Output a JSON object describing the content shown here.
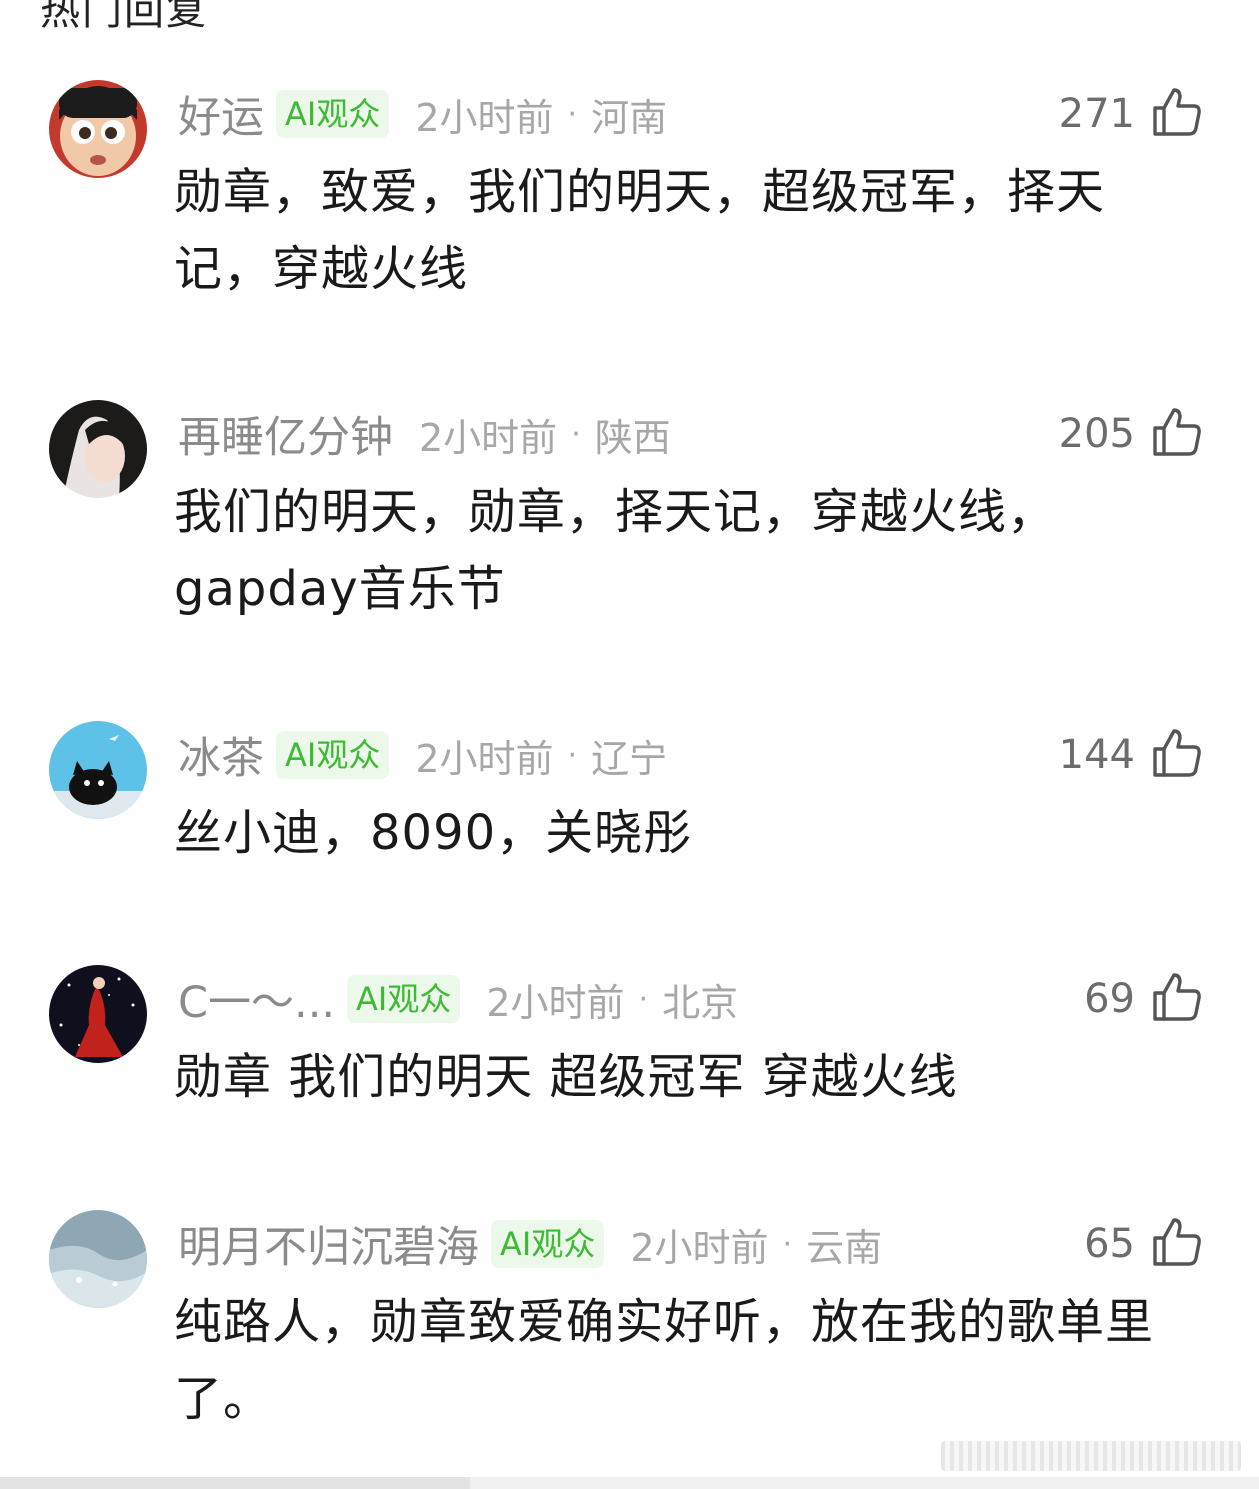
{
  "header": {
    "title": "热门回复"
  },
  "comments": [
    {
      "username": "好运",
      "badge": "AI观众",
      "time": "2小时前",
      "region": "河南",
      "likes": "271",
      "text": "勋章，致爱，我们的明天，超级冠军，择天记，穿越火线"
    },
    {
      "username": "再睡亿分钟",
      "badge": "",
      "time": "2小时前",
      "region": "陕西",
      "likes": "205",
      "text": "我们的明天，勋章，择天记，穿越火线，gapday音乐节"
    },
    {
      "username": "冰茶",
      "badge": "AI观众",
      "time": "2小时前",
      "region": "辽宁",
      "likes": "144",
      "text": "丝小迪，8090，关晓彤"
    },
    {
      "username": "C一～...",
      "badge": "AI观众",
      "time": "2小时前",
      "region": "北京",
      "likes": "69",
      "text": "勋章 我们的明天 超级冠军 穿越火线"
    },
    {
      "username": "明月不归沉碧海",
      "badge": "AI观众",
      "time": "2小时前",
      "region": "云南",
      "likes": "65",
      "text": "纯路人，勋章致爱确实好听，放在我的歌单里了。"
    }
  ],
  "meta_separator": "·",
  "icons": {
    "like": "thumbs-up-icon"
  },
  "colors": {
    "badge_text": "#3cbb32",
    "badge_bg": "#ecf8ea",
    "meta": "#a7a7a7"
  }
}
